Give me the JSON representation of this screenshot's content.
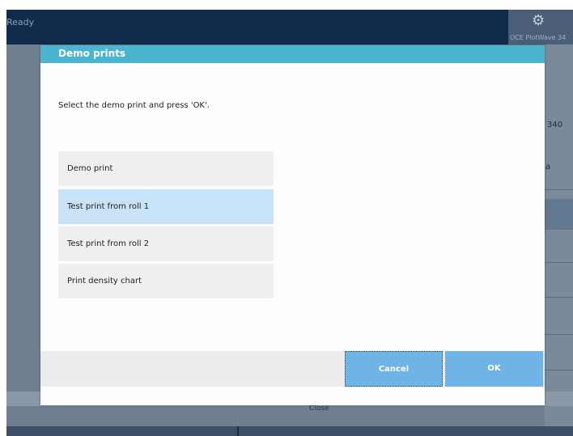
{
  "status_bar": {
    "status_text": "Ready",
    "printer_name": "OCE PlotWave 34",
    "settings_icon": "gear-icon"
  },
  "background": {
    "right_text_1": "340",
    "right_text_2": "a",
    "close_label": "Close"
  },
  "dialog": {
    "title": "Demo prints",
    "instruction": "Select the demo print and press 'OK'.",
    "options": [
      {
        "label": "Demo print",
        "selected": false
      },
      {
        "label": "Test print from roll 1",
        "selected": true
      },
      {
        "label": "Test print from roll 2",
        "selected": false
      },
      {
        "label": "Print density chart",
        "selected": false
      }
    ],
    "cancel_label": "Cancel",
    "ok_label": "OK"
  },
  "colors": {
    "header": "#4bb5cf",
    "selected_option": "#c8e2f7",
    "button": "#6fb3e7",
    "topbar": "#0f2a4a"
  }
}
